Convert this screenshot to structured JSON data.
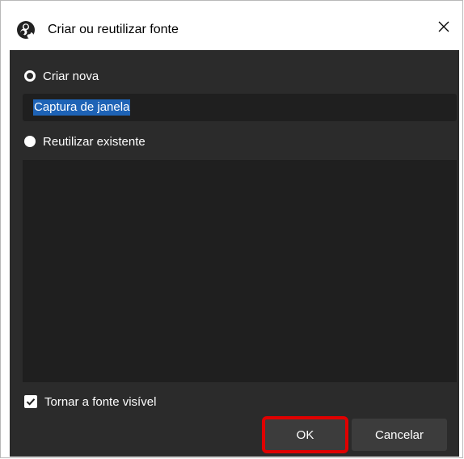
{
  "window": {
    "title": "Criar ou reutilizar fonte"
  },
  "options": {
    "create_new_label": "Criar nova",
    "name_value": "Captura de janela",
    "reuse_existing_label": "Reutilizar existente"
  },
  "visible_checkbox": {
    "label": "Tornar a fonte visível",
    "checked": true
  },
  "buttons": {
    "ok_label": "OK",
    "cancel_label": "Cancelar"
  },
  "icons": {
    "app": "obs-logo-icon",
    "close": "close-icon",
    "check": "checkmark-icon"
  },
  "colors": {
    "panel_bg": "#2b2b2b",
    "field_bg": "#1f1f1f",
    "selection": "#1e63b6",
    "button_bg": "#3c3c3c",
    "highlight": "#e00000"
  }
}
